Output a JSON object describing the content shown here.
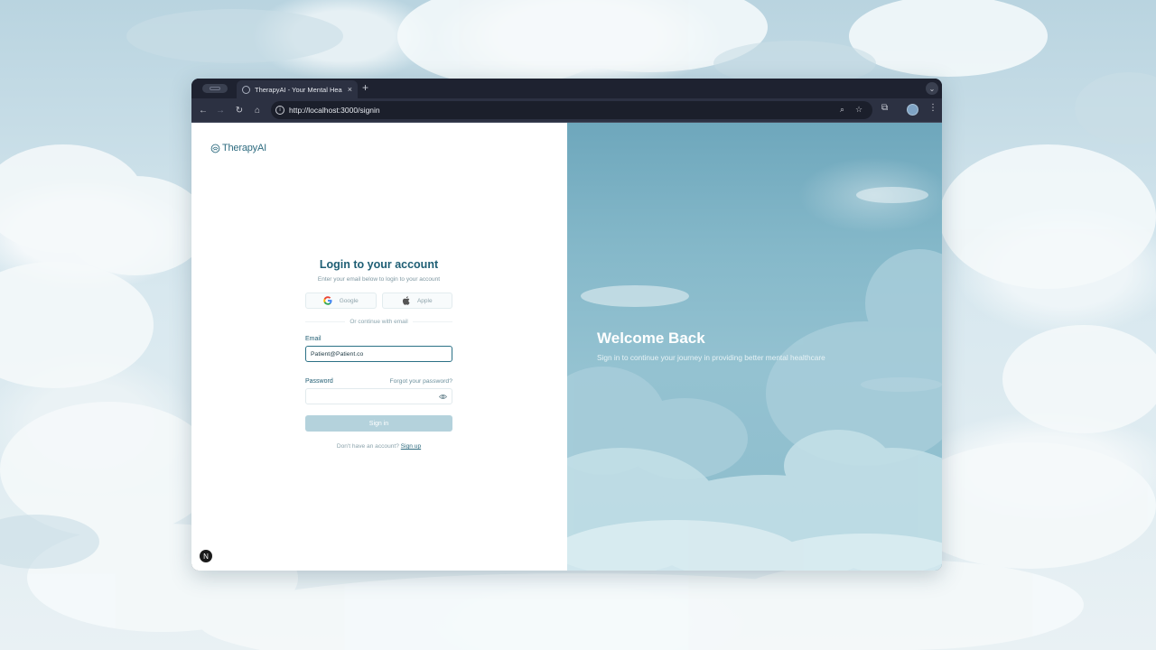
{
  "browser": {
    "tab_title": "TherapyAI - Your Mental Hea",
    "tab_close": "×",
    "new_tab": "+",
    "tab_menu": "⌄",
    "url": "http://localhost:3000/signin",
    "icons": [
      "back-arrow-icon",
      "forward-arrow-icon",
      "reload-icon",
      "home-icon",
      "site-info-icon",
      "zoom-icon",
      "bookmark-star-icon",
      "extensions-icon",
      "profile-avatar",
      "kebab-menu-icon"
    ]
  },
  "app": {
    "logo_text": "TherapyAI",
    "login": {
      "title": "Login to your account",
      "subtitle": "Enter your email below to login to your account",
      "google_label": "Google",
      "apple_label": "Apple",
      "divider_text": "Or continue with email",
      "email_label": "Email",
      "email_value": "Patient@Patient.co",
      "password_label": "Password",
      "forgot_label": "Forgot your password?",
      "signin_label": "Sign in",
      "signup_prompt": "Don't have an account?",
      "signup_link": "Sign up"
    },
    "hero": {
      "title": "Welcome Back",
      "subtitle": "Sign in to continue your journey in providing better mental healthcare"
    },
    "dev_badge": "N"
  },
  "colors": {
    "primary": "#1e5e74",
    "button_disabled": "#b4d2dc",
    "hero_bg": "#86b9ca",
    "chrome_dark": "#1e2230"
  }
}
